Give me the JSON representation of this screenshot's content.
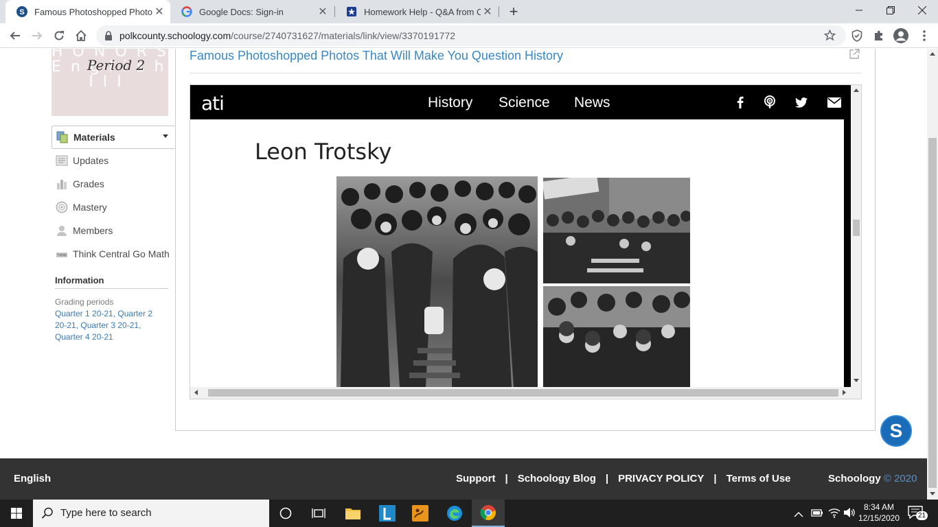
{
  "browser": {
    "tabs": [
      {
        "title": "Famous Photoshopped Photos Th",
        "active": true
      },
      {
        "title": "Google Docs: Sign-in",
        "active": false
      },
      {
        "title": "Homework Help - Q&A from Onl",
        "active": false
      }
    ],
    "new_tab": "+",
    "url_host": "polkcounty.schoology.com",
    "url_path": "/course/2740731627/materials/link/view/3370191772"
  },
  "sidebar": {
    "course_image": {
      "line1": "HONORS",
      "line2": "English",
      "line3": "III",
      "period": "Period 2"
    },
    "items": [
      {
        "label": "Materials",
        "icon": "materials-icon",
        "active": true
      },
      {
        "label": "Updates",
        "icon": "updates-icon"
      },
      {
        "label": "Grades",
        "icon": "grades-icon"
      },
      {
        "label": "Mastery",
        "icon": "mastery-icon"
      },
      {
        "label": "Members",
        "icon": "members-icon"
      },
      {
        "label": "Think Central Go Math",
        "icon": "external-tool-icon"
      }
    ],
    "information_heading": "Information",
    "grading_periods_label": "Grading periods",
    "grading_periods": "Quarter 1 20-21, Quarter 2 20-21, Quarter 3 20-21, Quarter 4 20-21"
  },
  "main": {
    "title": "Famous Photoshopped Photos That Will Make You Question History",
    "embed": {
      "logo": "ati",
      "nav": [
        "History",
        "Science",
        "News"
      ],
      "social": [
        "facebook-icon",
        "podcast-icon",
        "twitter-icon",
        "email-icon"
      ],
      "article_title": "Leon Trotsky"
    }
  },
  "footer": {
    "language": "English",
    "links": [
      "Support",
      "Schoology Blog",
      "PRIVACY POLICY",
      "Terms of Use"
    ],
    "brand": "Schoology",
    "copyright": "© 2020"
  },
  "taskbar": {
    "search_placeholder": "Type here to search",
    "time": "8:34 AM",
    "date": "12/15/2020",
    "notification_count": "21"
  },
  "colors": {
    "link_blue": "#3a87c3",
    "footer_bg": "#333333",
    "ati_black": "#000000"
  }
}
